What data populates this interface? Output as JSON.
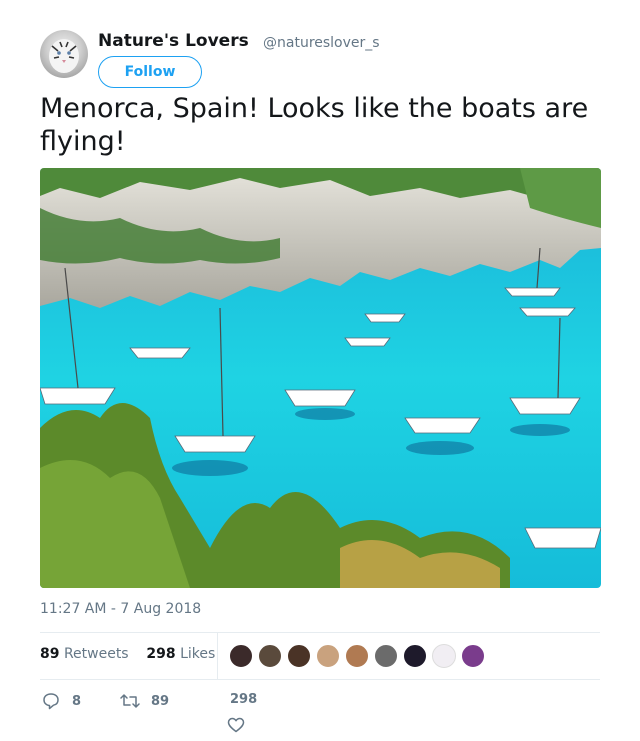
{
  "author": {
    "display_name": "Nature's Lovers",
    "screen_name": "@natureslover_s",
    "follow_label": "Follow",
    "avatar_icon": "white-tiger-avatar"
  },
  "tweet": {
    "text": "Menorca, Spain! Looks like the boats are flying!",
    "media_icon": "menorca-bay-photo",
    "timestamp": "11:27 AM - 7 Aug 2018"
  },
  "stats": {
    "retweets_count": "89",
    "retweets_label": "Retweets",
    "likes_count": "298",
    "likes_label": "Likes",
    "liker_colors": [
      "#3b2a2a",
      "#5a4a3c",
      "#4a3326",
      "#c9a27e",
      "#b07a52",
      "#6b6b6b",
      "#1e1a2b",
      "#f1eef3",
      "#7a3c8c"
    ]
  },
  "actions": {
    "reply_count": "8",
    "retweet_count": "89",
    "like_count": "298"
  },
  "colors": {
    "accent": "#1da1f2",
    "secondary_text": "#657786",
    "primary_text": "#14171a"
  }
}
